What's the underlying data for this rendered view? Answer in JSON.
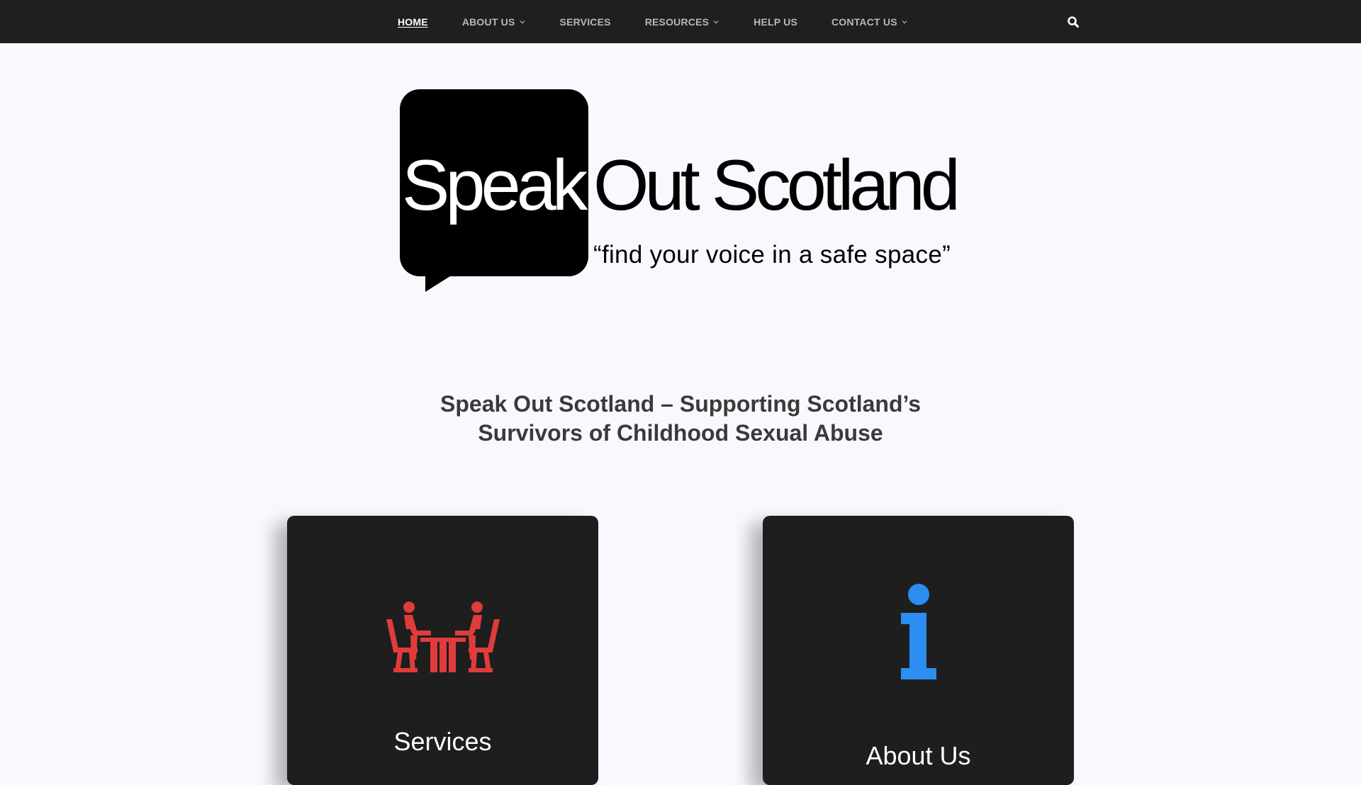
{
  "nav": {
    "items": [
      {
        "label": "HOME",
        "active": true,
        "dropdown": false
      },
      {
        "label": "ABOUT US",
        "active": false,
        "dropdown": true
      },
      {
        "label": "SERVICES",
        "active": false,
        "dropdown": false
      },
      {
        "label": "RESOURCES",
        "active": false,
        "dropdown": true
      },
      {
        "label": "HELP US",
        "active": false,
        "dropdown": false
      },
      {
        "label": "CONTACT US",
        "active": false,
        "dropdown": true
      }
    ],
    "search_icon": "search-icon"
  },
  "logo": {
    "bubble_word": "Speak",
    "rest": "Out Scotland",
    "tagline": "“find your voice in a safe space”"
  },
  "headline": {
    "line1": "Speak Out Scotland – Supporting Scotland’s",
    "line2": "Survivors of Childhood Sexual Abuse"
  },
  "cards": {
    "services": {
      "title": "Services",
      "icon": "meeting-icon",
      "icon_color": "#e03c3c"
    },
    "about": {
      "title": "About Us",
      "icon": "info-icon",
      "icon_color": "#2b8ef0"
    }
  },
  "colors": {
    "nav_bg": "#1f1f1f",
    "page_bg": "#f7f9fe",
    "card_bg": "#1e1e1e"
  }
}
